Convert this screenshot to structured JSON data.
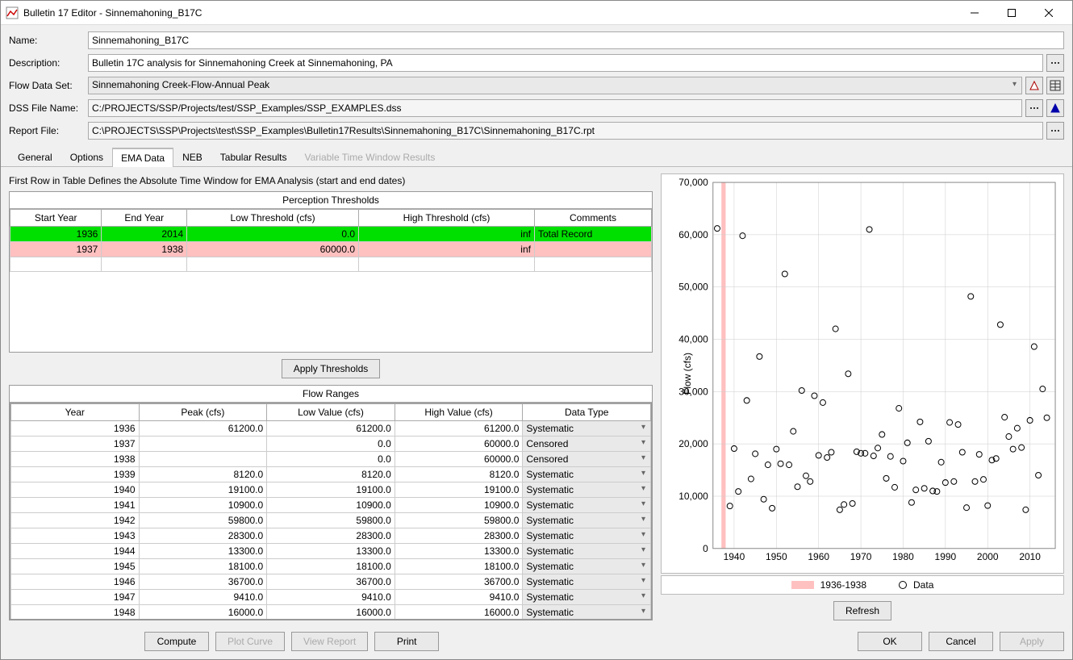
{
  "window": {
    "title": "Bulletin 17 Editor - Sinnemahoning_B17C"
  },
  "form": {
    "name_label": "Name:",
    "name_value": "Sinnemahoning_B17C",
    "desc_label": "Description:",
    "desc_value": "Bulletin 17C analysis for Sinnemahoning Creek at Sinnemahoning, PA",
    "flow_label": "Flow Data Set:",
    "flow_value": "Sinnemahoning Creek-Flow-Annual Peak",
    "dss_label": "DSS File Name:",
    "dss_value": "C:/PROJECTS/SSP/Projects/test/SSP_Examples/SSP_EXAMPLES.dss",
    "report_label": "Report File:",
    "report_value": "C:\\PROJECTS\\SSP\\Projects\\test\\SSP_Examples\\Bulletin17Results\\Sinnemahoning_B17C\\Sinnemahoning_B17C.rpt"
  },
  "tabs": {
    "general": "General",
    "options": "Options",
    "ema": "EMA Data",
    "neb": "NEB",
    "tabular": "Tabular Results",
    "variable": "Variable Time Window Results"
  },
  "ema": {
    "caption": "First Row in Table Defines the Absolute Time Window for EMA Analysis (start and end dates)",
    "thresh_title": "Perception Thresholds",
    "thresh_headers": {
      "start": "Start Year",
      "end": "End Year",
      "low": "Low Threshold (cfs)",
      "high": "High Threshold (cfs)",
      "comments": "Comments"
    },
    "thresh_rows": [
      {
        "start": "1936",
        "end": "2014",
        "low": "0.0",
        "high": "inf",
        "comments": "Total Record"
      },
      {
        "start": "1937",
        "end": "1938",
        "low": "60000.0",
        "high": "inf",
        "comments": ""
      }
    ],
    "apply_btn": "Apply Thresholds",
    "flow_title": "Flow Ranges",
    "flow_headers": {
      "year": "Year",
      "peak": "Peak (cfs)",
      "low": "Low Value (cfs)",
      "high": "High Value (cfs)",
      "type": "Data Type"
    },
    "flow_rows": [
      {
        "year": "1936",
        "peak": "61200.0",
        "low": "61200.0",
        "high": "61200.0",
        "type": "Systematic"
      },
      {
        "year": "1937",
        "peak": "",
        "low": "0.0",
        "high": "60000.0",
        "type": "Censored"
      },
      {
        "year": "1938",
        "peak": "",
        "low": "0.0",
        "high": "60000.0",
        "type": "Censored"
      },
      {
        "year": "1939",
        "peak": "8120.0",
        "low": "8120.0",
        "high": "8120.0",
        "type": "Systematic"
      },
      {
        "year": "1940",
        "peak": "19100.0",
        "low": "19100.0",
        "high": "19100.0",
        "type": "Systematic"
      },
      {
        "year": "1941",
        "peak": "10900.0",
        "low": "10900.0",
        "high": "10900.0",
        "type": "Systematic"
      },
      {
        "year": "1942",
        "peak": "59800.0",
        "low": "59800.0",
        "high": "59800.0",
        "type": "Systematic"
      },
      {
        "year": "1943",
        "peak": "28300.0",
        "low": "28300.0",
        "high": "28300.0",
        "type": "Systematic"
      },
      {
        "year": "1944",
        "peak": "13300.0",
        "low": "13300.0",
        "high": "13300.0",
        "type": "Systematic"
      },
      {
        "year": "1945",
        "peak": "18100.0",
        "low": "18100.0",
        "high": "18100.0",
        "type": "Systematic"
      },
      {
        "year": "1946",
        "peak": "36700.0",
        "low": "36700.0",
        "high": "36700.0",
        "type": "Systematic"
      },
      {
        "year": "1947",
        "peak": "9410.0",
        "low": "9410.0",
        "high": "9410.0",
        "type": "Systematic"
      },
      {
        "year": "1948",
        "peak": "16000.0",
        "low": "16000.0",
        "high": "16000.0",
        "type": "Systematic"
      }
    ]
  },
  "chart_data": {
    "type": "scatter",
    "ylabel": "Flow (cfs)",
    "ylim": [
      0,
      70000
    ],
    "yticks": [
      0,
      10000,
      20000,
      30000,
      40000,
      50000,
      60000,
      70000
    ],
    "ytick_labels": [
      "0",
      "10,000",
      "20,000",
      "30,000",
      "40,000",
      "50,000",
      "60,000",
      "70,000"
    ],
    "xlim": [
      1935,
      2016
    ],
    "xticks": [
      1940,
      1950,
      1960,
      1970,
      1980,
      1990,
      2000,
      2010
    ],
    "shade": {
      "start": 1937,
      "end": 1938,
      "label": "1936-1938"
    },
    "legend_data": "Data",
    "points": [
      {
        "x": 1936,
        "y": 61200
      },
      {
        "x": 1939,
        "y": 8120
      },
      {
        "x": 1940,
        "y": 19100
      },
      {
        "x": 1941,
        "y": 10900
      },
      {
        "x": 1942,
        "y": 59800
      },
      {
        "x": 1943,
        "y": 28300
      },
      {
        "x": 1944,
        "y": 13300
      },
      {
        "x": 1945,
        "y": 18100
      },
      {
        "x": 1946,
        "y": 36700
      },
      {
        "x": 1947,
        "y": 9410
      },
      {
        "x": 1948,
        "y": 16000
      },
      {
        "x": 1949,
        "y": 7700
      },
      {
        "x": 1950,
        "y": 19000
      },
      {
        "x": 1951,
        "y": 16200
      },
      {
        "x": 1952,
        "y": 52500
      },
      {
        "x": 1953,
        "y": 16000
      },
      {
        "x": 1954,
        "y": 22400
      },
      {
        "x": 1955,
        "y": 11800
      },
      {
        "x": 1956,
        "y": 30200
      },
      {
        "x": 1957,
        "y": 13900
      },
      {
        "x": 1958,
        "y": 12800
      },
      {
        "x": 1959,
        "y": 29200
      },
      {
        "x": 1960,
        "y": 17800
      },
      {
        "x": 1961,
        "y": 27900
      },
      {
        "x": 1962,
        "y": 17400
      },
      {
        "x": 1963,
        "y": 18400
      },
      {
        "x": 1964,
        "y": 42000
      },
      {
        "x": 1965,
        "y": 7400
      },
      {
        "x": 1966,
        "y": 8400
      },
      {
        "x": 1967,
        "y": 33400
      },
      {
        "x": 1968,
        "y": 8600
      },
      {
        "x": 1969,
        "y": 18500
      },
      {
        "x": 1970,
        "y": 18200
      },
      {
        "x": 1971,
        "y": 18200
      },
      {
        "x": 1972,
        "y": 61000
      },
      {
        "x": 1973,
        "y": 17700
      },
      {
        "x": 1974,
        "y": 19200
      },
      {
        "x": 1975,
        "y": 21800
      },
      {
        "x": 1976,
        "y": 13400
      },
      {
        "x": 1977,
        "y": 17600
      },
      {
        "x": 1978,
        "y": 11700
      },
      {
        "x": 1979,
        "y": 26800
      },
      {
        "x": 1980,
        "y": 16700
      },
      {
        "x": 1981,
        "y": 20200
      },
      {
        "x": 1982,
        "y": 8800
      },
      {
        "x": 1983,
        "y": 11200
      },
      {
        "x": 1984,
        "y": 24200
      },
      {
        "x": 1985,
        "y": 11500
      },
      {
        "x": 1986,
        "y": 20500
      },
      {
        "x": 1987,
        "y": 11000
      },
      {
        "x": 1988,
        "y": 10900
      },
      {
        "x": 1989,
        "y": 16500
      },
      {
        "x": 1990,
        "y": 12600
      },
      {
        "x": 1991,
        "y": 24100
      },
      {
        "x": 1992,
        "y": 12800
      },
      {
        "x": 1993,
        "y": 23700
      },
      {
        "x": 1994,
        "y": 18400
      },
      {
        "x": 1995,
        "y": 7800
      },
      {
        "x": 1996,
        "y": 48200
      },
      {
        "x": 1997,
        "y": 12800
      },
      {
        "x": 1998,
        "y": 18000
      },
      {
        "x": 1999,
        "y": 13200
      },
      {
        "x": 2000,
        "y": 8200
      },
      {
        "x": 2001,
        "y": 16900
      },
      {
        "x": 2002,
        "y": 17200
      },
      {
        "x": 2003,
        "y": 42800
      },
      {
        "x": 2004,
        "y": 25100
      },
      {
        "x": 2005,
        "y": 21400
      },
      {
        "x": 2006,
        "y": 19000
      },
      {
        "x": 2007,
        "y": 23000
      },
      {
        "x": 2008,
        "y": 19300
      },
      {
        "x": 2009,
        "y": 7400
      },
      {
        "x": 2010,
        "y": 24500
      },
      {
        "x": 2011,
        "y": 38600
      },
      {
        "x": 2012,
        "y": 14000
      },
      {
        "x": 2013,
        "y": 30500
      },
      {
        "x": 2014,
        "y": 25000
      }
    ]
  },
  "footer": {
    "compute": "Compute",
    "plot": "Plot Curve",
    "view": "View Report",
    "print": "Print",
    "ok": "OK",
    "cancel": "Cancel",
    "apply": "Apply",
    "refresh": "Refresh"
  }
}
